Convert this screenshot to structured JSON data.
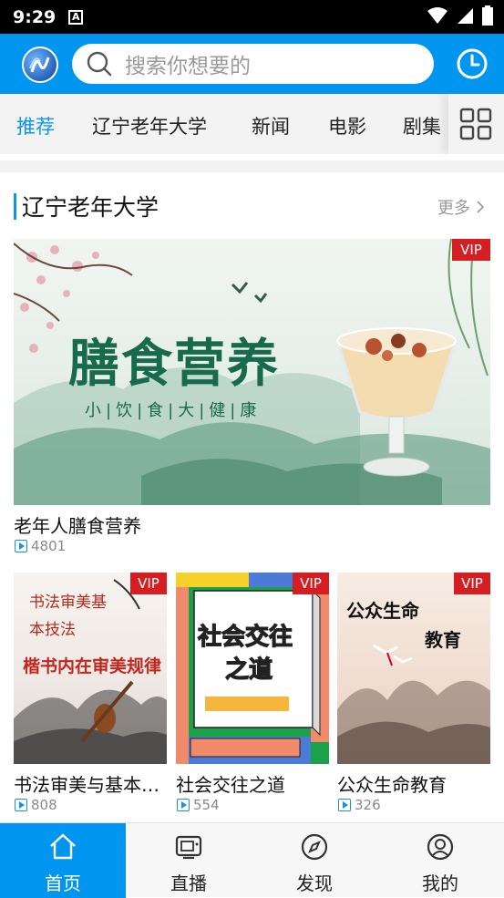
{
  "status_bar": {
    "time": "9:29",
    "notif_glyph": "A"
  },
  "header": {
    "search_placeholder": "搜索你想要的"
  },
  "tabs": [
    {
      "label": "推荐"
    },
    {
      "label": "辽宁老年大学"
    },
    {
      "label": "新闻"
    },
    {
      "label": "电影"
    },
    {
      "label": "剧集"
    }
  ],
  "section": {
    "title": "辽宁老年大学",
    "more": "更多"
  },
  "featured": {
    "vip": "VIP",
    "banner_title": "膳食营养",
    "banner_subtitle": "小|饮|食|大|健|康",
    "title": "老年人膳食营养",
    "count": "4801"
  },
  "cards": [
    {
      "vip": "VIP",
      "art_line1": "书法审美基",
      "art_line2": "本技法",
      "art_line3": "楷书内在审美规律",
      "title": "书法审美与基本…",
      "count": "808"
    },
    {
      "vip": "VIP",
      "art_line1": "社会交往",
      "art_line2": "之道",
      "title": "社会交往之道",
      "count": "554"
    },
    {
      "vip": "VIP",
      "art_line1": "公众生命",
      "art_line2": "教育",
      "title": "公众生命教育",
      "count": "326"
    }
  ],
  "bottom_nav": [
    {
      "label": "首页",
      "icon": "home-icon"
    },
    {
      "label": "直播",
      "icon": "tv-icon"
    },
    {
      "label": "发现",
      "icon": "compass-icon"
    },
    {
      "label": "我的",
      "icon": "user-icon"
    }
  ],
  "colors": {
    "accent": "#0095ef",
    "vip": "#d41e22"
  }
}
